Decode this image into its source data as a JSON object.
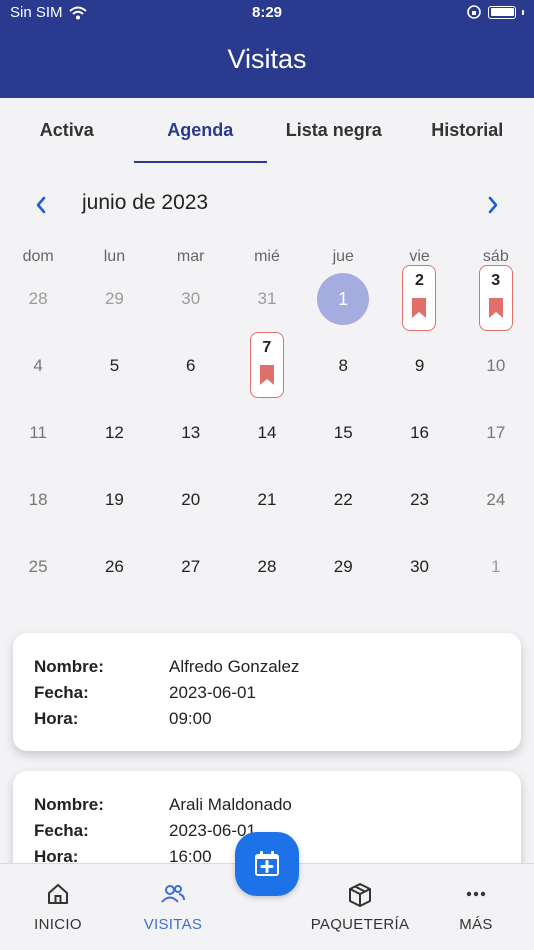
{
  "status": {
    "carrier": "Sin SIM",
    "time": "8:29"
  },
  "header": {
    "title": "Visitas"
  },
  "tabs": [
    {
      "label": "Activa"
    },
    {
      "label": "Agenda"
    },
    {
      "label": "Lista negra"
    },
    {
      "label": "Historial"
    }
  ],
  "calendar": {
    "month": "junio de 2023",
    "weekdays": [
      "dom",
      "lun",
      "mar",
      "mié",
      "jue",
      "vie",
      "sáb"
    ],
    "weeks": [
      [
        "28",
        "29",
        "30",
        "31",
        "1",
        "2",
        "3"
      ],
      [
        "4",
        "5",
        "6",
        "7",
        "8",
        "9",
        "10"
      ],
      [
        "11",
        "12",
        "13",
        "14",
        "15",
        "16",
        "17"
      ],
      [
        "18",
        "19",
        "20",
        "21",
        "22",
        "23",
        "24"
      ],
      [
        "25",
        "26",
        "27",
        "28",
        "29",
        "30",
        "1"
      ]
    ],
    "selected_day": "1",
    "marked_days": [
      "2",
      "3",
      "7"
    ],
    "accent_color": "#e0716a",
    "selected_color": "#a5ade0"
  },
  "visits": [
    {
      "name_label": "Nombre:",
      "name": "Alfredo Gonzalez",
      "date_label": "Fecha:",
      "date": "2023-06-01",
      "time_label": "Hora:",
      "time": "09:00"
    },
    {
      "name_label": "Nombre:",
      "name": "Arali Maldonado",
      "date_label": "Fecha:",
      "date": "2023-06-01",
      "time_label": "Hora:",
      "time": "16:00"
    }
  ],
  "bottom_nav": [
    {
      "label": "INICIO",
      "icon": "home-icon"
    },
    {
      "label": "VISITAS",
      "icon": "users-icon"
    },
    {
      "label": "PAQUETERÍA",
      "icon": "package-icon"
    },
    {
      "label": "MÁS",
      "icon": "more-icon"
    }
  ],
  "colors": {
    "header": "#2a3a8f",
    "active_nav": "#3a6fd8",
    "fab": "#1e72e8"
  }
}
